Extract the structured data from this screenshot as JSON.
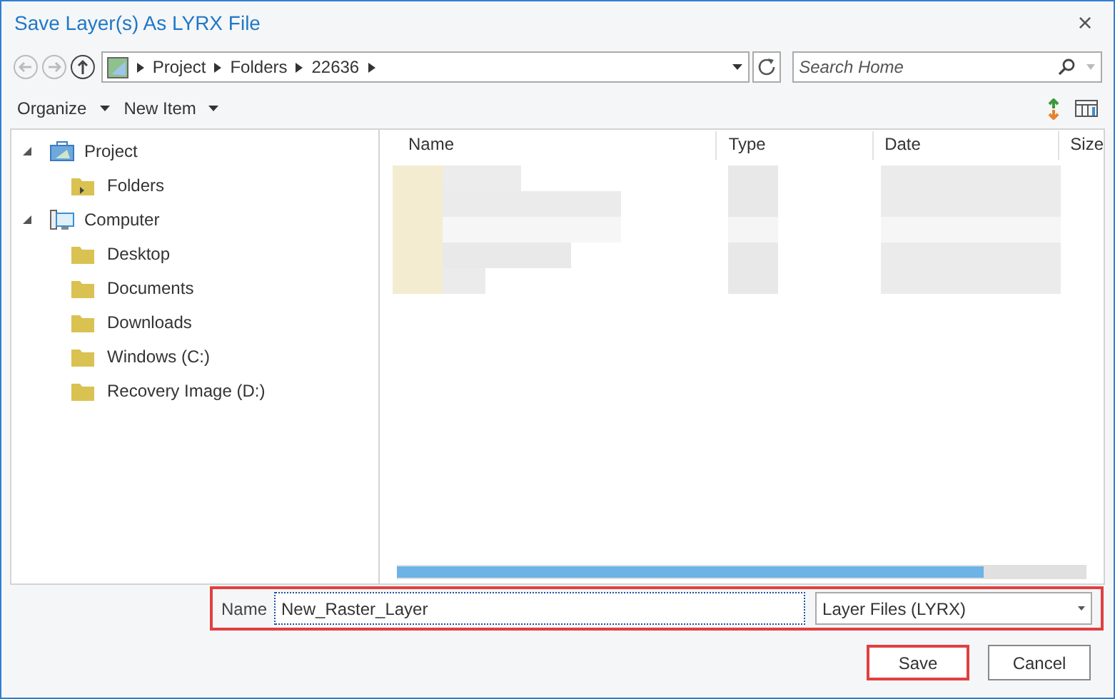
{
  "window": {
    "title": "Save Layer(s) As LYRX File",
    "close": "×"
  },
  "address_bar": {
    "path": [
      "Project",
      "Folders",
      "22636"
    ]
  },
  "search": {
    "placeholder": "Search Home"
  },
  "toolbar": {
    "items": [
      "Organize",
      "New Item"
    ]
  },
  "tree": [
    {
      "label": "Project",
      "kind": "project",
      "expanded": true,
      "children": [
        {
          "label": "Folders",
          "kind": "folder-link"
        }
      ]
    },
    {
      "label": "Computer",
      "kind": "computer",
      "expanded": true,
      "children": [
        {
          "label": "Desktop",
          "kind": "folder"
        },
        {
          "label": "Documents",
          "kind": "folder"
        },
        {
          "label": "Downloads",
          "kind": "folder"
        },
        {
          "label": "Windows (C:)",
          "kind": "folder"
        },
        {
          "label": "Recovery Image (D:)",
          "kind": "folder"
        }
      ]
    }
  ],
  "file_list": {
    "columns": [
      "Name",
      "Type",
      "Date",
      "Size"
    ]
  },
  "name_row": {
    "label": "Name",
    "value": "New_Raster_Layer",
    "file_type": "Layer Files (LYRX)",
    "highlighted": true
  },
  "buttons": [
    {
      "label": "Save",
      "highlighted": true
    },
    {
      "label": "Cancel",
      "highlighted": false
    }
  ]
}
